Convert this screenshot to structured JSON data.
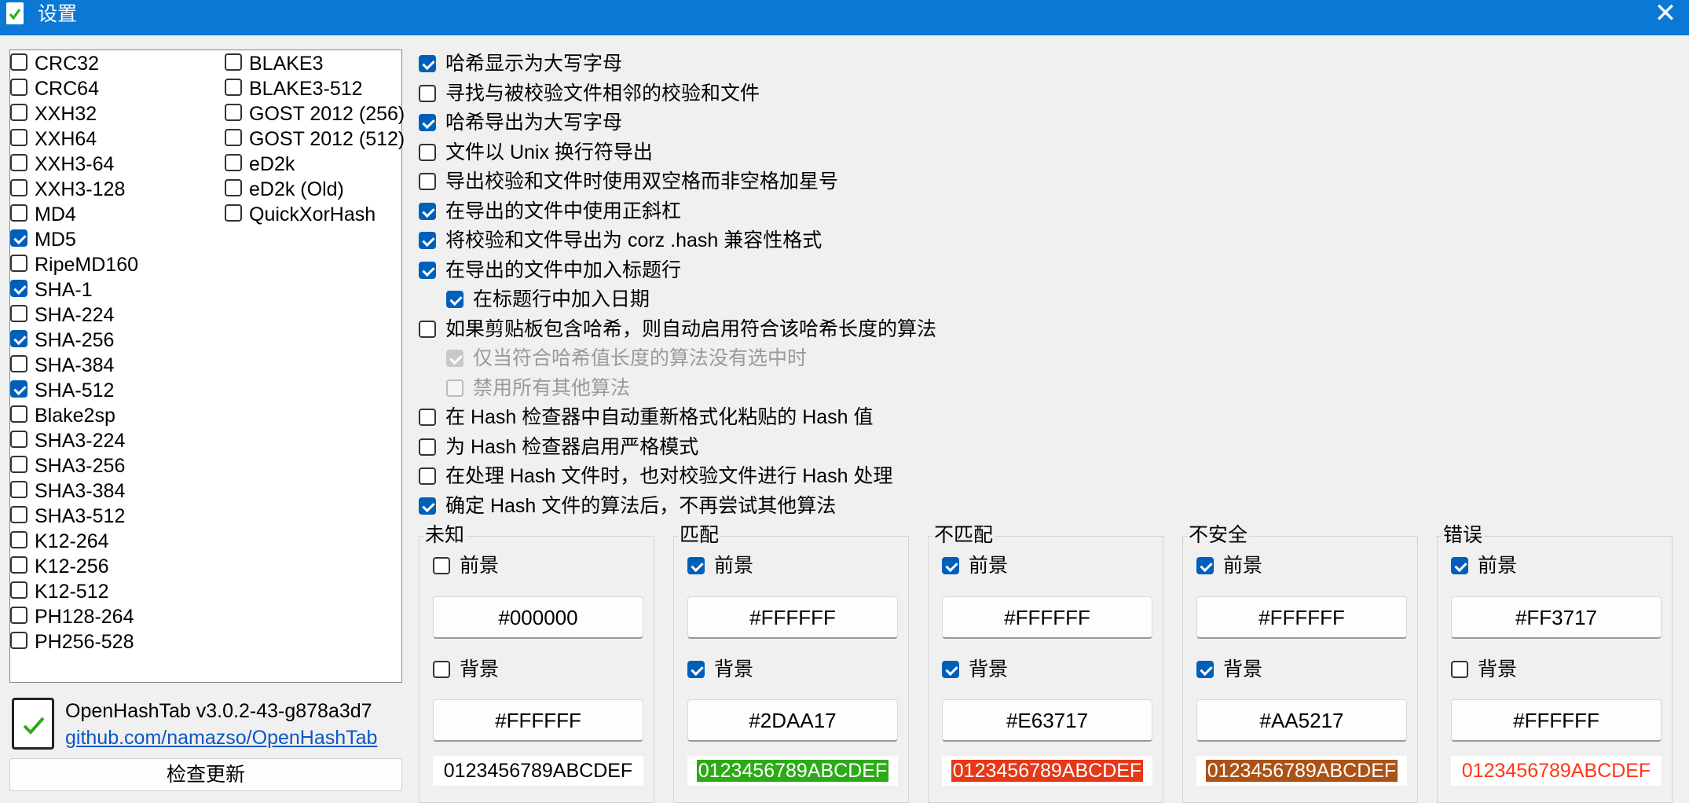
{
  "window": {
    "title": "设置",
    "close_glyph": "✕",
    "icon": "app-icon"
  },
  "algorithms": {
    "col1": [
      {
        "label": "CRC32",
        "checked": false
      },
      {
        "label": "CRC64",
        "checked": false
      },
      {
        "label": "XXH32",
        "checked": false
      },
      {
        "label": "XXH64",
        "checked": false
      },
      {
        "label": "XXH3-64",
        "checked": false
      },
      {
        "label": "XXH3-128",
        "checked": false
      },
      {
        "label": "MD4",
        "checked": false
      },
      {
        "label": "MD5",
        "checked": true
      },
      {
        "label": "RipeMD160",
        "checked": false
      },
      {
        "label": "SHA-1",
        "checked": true
      },
      {
        "label": "SHA-224",
        "checked": false
      },
      {
        "label": "SHA-256",
        "checked": true
      },
      {
        "label": "SHA-384",
        "checked": false
      },
      {
        "label": "SHA-512",
        "checked": true
      },
      {
        "label": "Blake2sp",
        "checked": false
      },
      {
        "label": "SHA3-224",
        "checked": false
      },
      {
        "label": "SHA3-256",
        "checked": false
      },
      {
        "label": "SHA3-384",
        "checked": false
      },
      {
        "label": "SHA3-512",
        "checked": false
      },
      {
        "label": "K12-264",
        "checked": false
      },
      {
        "label": "K12-256",
        "checked": false
      },
      {
        "label": "K12-512",
        "checked": false
      },
      {
        "label": "PH128-264",
        "checked": false
      },
      {
        "label": "PH256-528",
        "checked": false
      }
    ],
    "col2": [
      {
        "label": "BLAKE3",
        "checked": false
      },
      {
        "label": "BLAKE3-512",
        "checked": false
      },
      {
        "label": "GOST 2012 (256)",
        "checked": false
      },
      {
        "label": "GOST 2012 (512)",
        "checked": false
      },
      {
        "label": "eD2k",
        "checked": false
      },
      {
        "label": "eD2k (Old)",
        "checked": false
      },
      {
        "label": "QuickXorHash",
        "checked": false
      }
    ]
  },
  "options": [
    {
      "label": "哈希显示为大写字母",
      "checked": true,
      "indent": 0,
      "disabled": false
    },
    {
      "label": "寻找与被校验文件相邻的校验和文件",
      "checked": false,
      "indent": 0,
      "disabled": false
    },
    {
      "label": "哈希导出为大写字母",
      "checked": true,
      "indent": 0,
      "disabled": false
    },
    {
      "label": "文件以 Unix 换行符导出",
      "checked": false,
      "indent": 0,
      "disabled": false
    },
    {
      "label": "导出校验和文件时使用双空格而非空格加星号",
      "checked": false,
      "indent": 0,
      "disabled": false
    },
    {
      "label": "在导出的文件中使用正斜杠",
      "checked": true,
      "indent": 0,
      "disabled": false
    },
    {
      "label": "将校验和文件导出为 corz .hash 兼容性格式",
      "checked": true,
      "indent": 0,
      "disabled": false
    },
    {
      "label": "在导出的文件中加入标题行",
      "checked": true,
      "indent": 0,
      "disabled": false
    },
    {
      "label": "在标题行中加入日期",
      "checked": true,
      "indent": 1,
      "disabled": false
    },
    {
      "label": "如果剪贴板包含哈希，则自动启用符合该哈希长度的算法",
      "checked": false,
      "indent": 0,
      "disabled": false
    },
    {
      "label": "仅当符合哈希值长度的算法没有选中时",
      "checked": true,
      "indent": 1,
      "disabled": true
    },
    {
      "label": "禁用所有其他算法",
      "checked": false,
      "indent": 1,
      "disabled": true
    },
    {
      "label": "在 Hash 检查器中自动重新格式化粘贴的 Hash 值",
      "checked": false,
      "indent": 0,
      "disabled": false
    },
    {
      "label": "为 Hash 检查器启用严格模式",
      "checked": false,
      "indent": 0,
      "disabled": false
    },
    {
      "label": "在处理 Hash 文件时，也对校验文件进行 Hash 处理",
      "checked": false,
      "indent": 0,
      "disabled": false
    },
    {
      "label": "确定 Hash 文件的算法后，不再尝试其他算法",
      "checked": true,
      "indent": 0,
      "disabled": false
    }
  ],
  "color_groups": [
    {
      "title": "未知",
      "fg_label": "前景",
      "fg_checked": false,
      "fg_value": "#000000",
      "bg_label": "背景",
      "bg_checked": false,
      "bg_value": "#FFFFFF",
      "preview": "0123456789ABCDEF",
      "preview_fg": "#000000",
      "preview_bg": "#FFFFFF"
    },
    {
      "title": "匹配",
      "fg_label": "前景",
      "fg_checked": true,
      "fg_value": "#FFFFFF",
      "bg_label": "背景",
      "bg_checked": true,
      "bg_value": "#2DAA17",
      "preview": "0123456789ABCDEF",
      "preview_fg": "#FFFFFF",
      "preview_bg": "#2DAA17"
    },
    {
      "title": "不匹配",
      "fg_label": "前景",
      "fg_checked": true,
      "fg_value": "#FFFFFF",
      "bg_label": "背景",
      "bg_checked": true,
      "bg_value": "#E63717",
      "preview": "0123456789ABCDEF",
      "preview_fg": "#FFFFFF",
      "preview_bg": "#E63717"
    },
    {
      "title": "不安全",
      "fg_label": "前景",
      "fg_checked": true,
      "fg_value": "#FFFFFF",
      "bg_label": "背景",
      "bg_checked": true,
      "bg_value": "#AA5217",
      "preview": "0123456789ABCDEF",
      "preview_fg": "#FFFFFF",
      "preview_bg": "#AA5217"
    },
    {
      "title": "错误",
      "fg_label": "前景",
      "fg_checked": true,
      "fg_value": "#FF3717",
      "bg_label": "背景",
      "bg_checked": false,
      "bg_value": "#FFFFFF",
      "preview": "0123456789ABCDEF",
      "preview_fg": "#FF3717",
      "preview_bg": "#FFFFFF"
    }
  ],
  "about": {
    "version": "OpenHashTab v3.0.2-43-g878a3d7",
    "link": "github.com/namazso/OpenHashTab",
    "check_update": "检查更新"
  },
  "colors": {
    "titlebar": "#0A78D4",
    "accent": "#005FB8",
    "link": "#0B57C4"
  }
}
